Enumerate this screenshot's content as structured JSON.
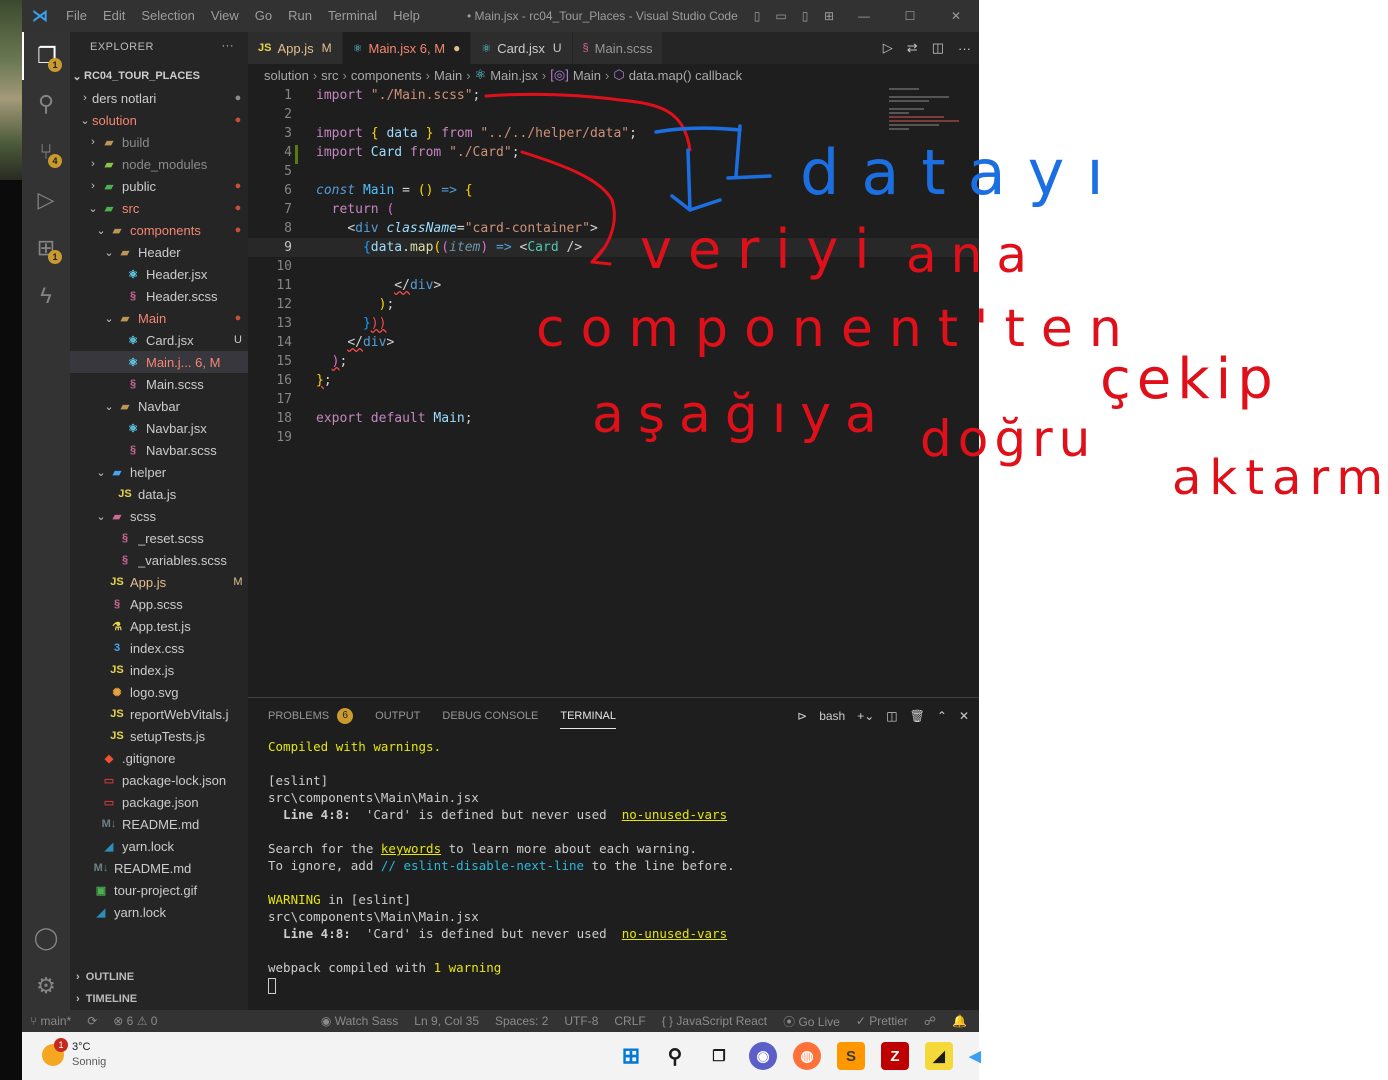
{
  "window": {
    "menu": [
      "File",
      "Edit",
      "Selection",
      "View",
      "Go",
      "Run",
      "Terminal",
      "Help"
    ],
    "title": "• Main.jsx - rc04_Tour_Places - Visual Studio Code"
  },
  "activity": {
    "explorer_badge": "1",
    "scm_badge": "4",
    "extensions_badge": "1"
  },
  "explorer": {
    "header": "EXPLORER",
    "more": "···",
    "root": "RC04_TOUR_PLACES",
    "items": [
      {
        "label": "ders notlari",
        "status": "●"
      },
      {
        "label": "solution",
        "status": "●"
      },
      {
        "label": "build",
        "status": ""
      },
      {
        "label": "node_modules",
        "status": ""
      },
      {
        "label": "public",
        "status": "●"
      },
      {
        "label": "src",
        "status": "●"
      },
      {
        "label": "components",
        "status": "●"
      },
      {
        "label": "Header",
        "status": ""
      },
      {
        "label": "Header.jsx",
        "status": ""
      },
      {
        "label": "Header.scss",
        "status": ""
      },
      {
        "label": "Main",
        "status": "●"
      },
      {
        "label": "Card.jsx",
        "status": "U"
      },
      {
        "label": "Main.j... 6, M",
        "status": ""
      },
      {
        "label": "Main.scss",
        "status": ""
      },
      {
        "label": "Navbar",
        "status": ""
      },
      {
        "label": "Navbar.jsx",
        "status": ""
      },
      {
        "label": "Navbar.scss",
        "status": ""
      },
      {
        "label": "helper",
        "status": ""
      },
      {
        "label": "data.js",
        "status": ""
      },
      {
        "label": "scss",
        "status": ""
      },
      {
        "label": "_reset.scss",
        "status": ""
      },
      {
        "label": "_variables.scss",
        "status": ""
      },
      {
        "label": "App.js",
        "status": "M"
      },
      {
        "label": "App.scss",
        "status": ""
      },
      {
        "label": "App.test.js",
        "status": ""
      },
      {
        "label": "index.css",
        "status": ""
      },
      {
        "label": "index.js",
        "status": ""
      },
      {
        "label": "logo.svg",
        "status": ""
      },
      {
        "label": "reportWebVitals.js",
        "status": ""
      },
      {
        "label": "setupTests.js",
        "status": ""
      },
      {
        "label": ".gitignore",
        "status": ""
      },
      {
        "label": "package-lock.json",
        "status": ""
      },
      {
        "label": "package.json",
        "status": ""
      },
      {
        "label": "README.md",
        "status": ""
      },
      {
        "label": "yarn.lock",
        "status": ""
      },
      {
        "label": "README.md",
        "status": ""
      },
      {
        "label": "tour-project.gif",
        "status": ""
      },
      {
        "label": "yarn.lock",
        "status": ""
      }
    ],
    "outline": "OUTLINE",
    "timeline": "TIMELINE"
  },
  "tabs": [
    {
      "icon": "JS",
      "label": "App.js",
      "status": "M"
    },
    {
      "icon": "⚛",
      "label": "Main.jsx 6, M",
      "status": "●"
    },
    {
      "icon": "⚛",
      "label": "Card.jsx",
      "status": "U"
    },
    {
      "icon": "§",
      "label": "Main.scss",
      "status": ""
    }
  ],
  "breadcrumb": [
    "solution",
    "src",
    "components",
    "Main",
    "Main.jsx",
    "Main",
    "data.map() callback"
  ],
  "code": {
    "line_numbers": [
      "1",
      "2",
      "3",
      "4",
      "5",
      "6",
      "7",
      "8",
      "9",
      "10",
      "11",
      "12",
      "13",
      "14",
      "15",
      "16",
      "17",
      "18",
      "19"
    ],
    "current_line": "9"
  },
  "panel": {
    "tabs": [
      "PROBLEMS",
      "OUTPUT",
      "DEBUG CONSOLE",
      "TERMINAL"
    ],
    "problems_count": "6",
    "shell": "bash",
    "terminal": {
      "compiled": "Compiled with warnings.",
      "eslint": "[eslint]",
      "file": "src\\components\\Main\\Main.jsx",
      "line_loc": "  Line 4:8:",
      "line_msg": "  'Card' is defined but never used  ",
      "rule": "no-unused-vars",
      "search_pre": "Search for the ",
      "keywords": "keywords",
      "search_post": " to learn more about each warning.",
      "ignore_pre": "To ignore, add ",
      "ignore_comment": "// eslint-disable-next-line",
      "ignore_post": " to the line before.",
      "warning": "WARNING",
      "warning_in": " in [eslint]",
      "webpack_pre": "webpack compiled with ",
      "webpack_count": "1 warning"
    }
  },
  "statusbar": {
    "branch": "main*",
    "problems": "⊗ 6 ⚠ 0",
    "watch_sass": "Watch Sass",
    "position": "Ln 9, Col 35",
    "spaces": "Spaces: 2",
    "encoding": "UTF-8",
    "eol": "CRLF",
    "language": "{ } JavaScript React",
    "golive": "Go Live",
    "prettier": "✓ Prettier"
  },
  "taskbar": {
    "weather_temp": "3°C",
    "weather_desc": "Sonnig",
    "weather_badge": "1"
  },
  "annotations": {
    "blue_word": "datayı",
    "red_words": [
      "veriyi",
      "ana",
      "component'ten",
      "çekip",
      "aşağıya",
      "doğru",
      "aktarma"
    ]
  },
  "colors": {
    "editor_bg": "#1e1e1e",
    "sidebar_bg": "#252526",
    "accent_mod": "#e2c08d",
    "accent_err": "#f48771",
    "ink_red": "#e0101a",
    "ink_blue": "#1c6fe0"
  }
}
